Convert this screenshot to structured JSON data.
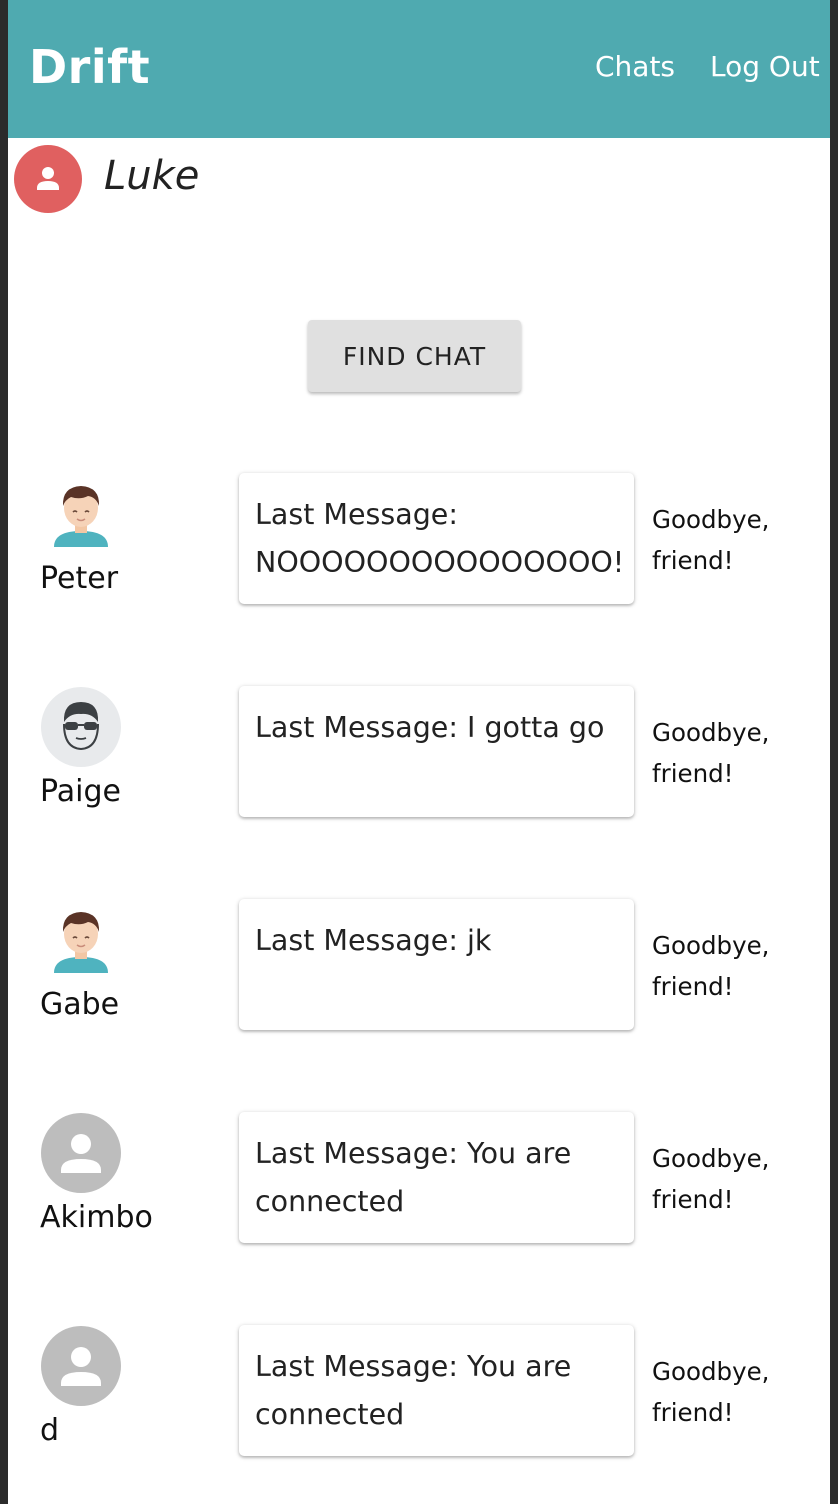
{
  "header": {
    "brand": "Drift",
    "nav": {
      "chats": "Chats",
      "logout": "Log Out"
    },
    "bg_color": "#4faab0"
  },
  "user": {
    "name": "Luke",
    "avatar_color": "#e06060",
    "avatar_icon": "person-icon"
  },
  "find_chat_label": "FIND CHAT",
  "contacts": [
    {
      "name": "Peter",
      "avatar": "boy-avatar-icon",
      "last_message": "Last Message: NOOOOOOOOOOOOOOO!",
      "status": "Goodbye, friend!"
    },
    {
      "name": "Paige",
      "avatar": "sunglasses-avatar-icon",
      "last_message": "Last Message: I gotta go",
      "status": "Goodbye, friend!"
    },
    {
      "name": "Gabe",
      "avatar": "boy-avatar-icon",
      "last_message": "Last Message: jk",
      "status": "Goodbye, friend!"
    },
    {
      "name": "Akimbo",
      "avatar": "default-person-icon",
      "last_message": "Last Message: You are connected",
      "status": "Goodbye, friend!"
    },
    {
      "name": "d",
      "avatar": "default-person-icon",
      "last_message": "Last Message: You are connected",
      "status": "Goodbye, friend!"
    }
  ]
}
